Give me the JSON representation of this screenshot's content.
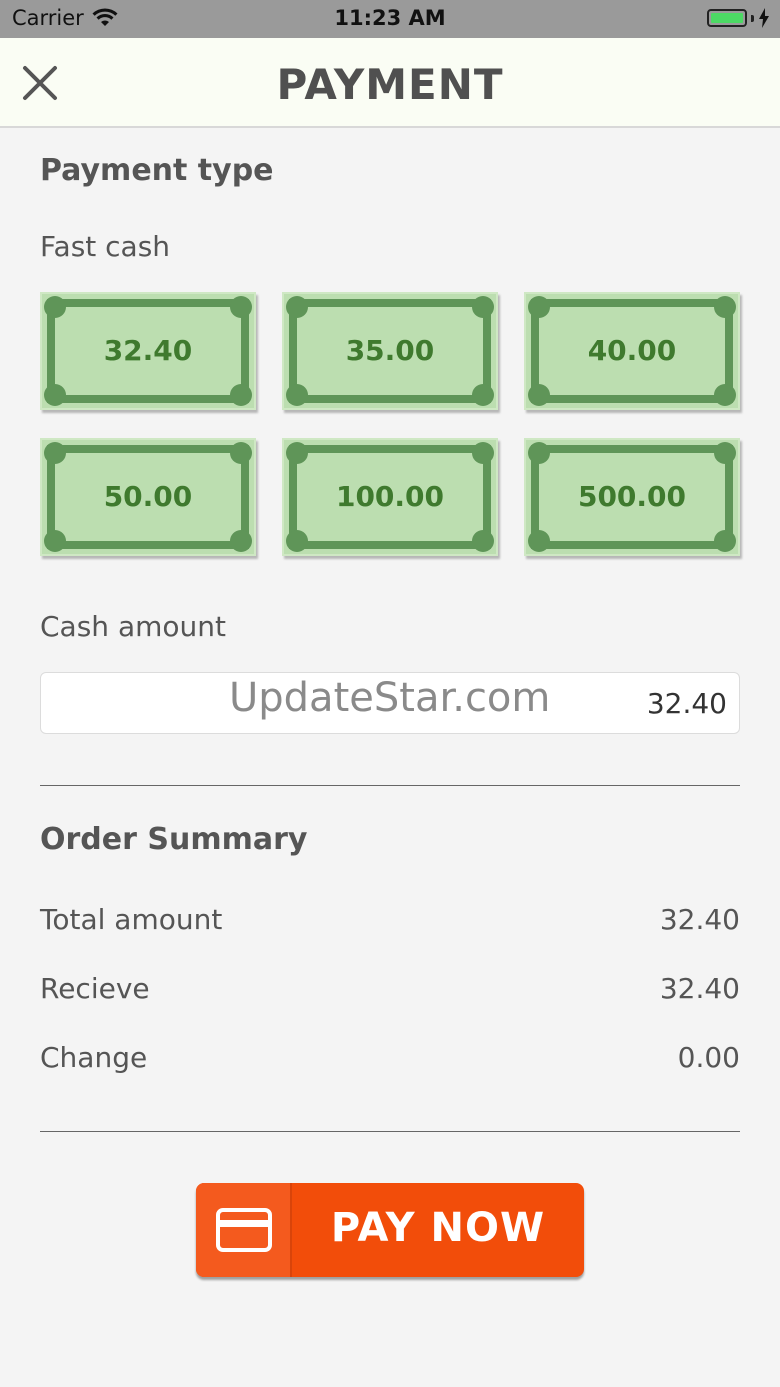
{
  "status_bar": {
    "carrier": "Carrier",
    "time": "11:23 AM",
    "battery_color": "#4cd964"
  },
  "header": {
    "title": "PAYMENT",
    "close_icon": "close-icon"
  },
  "payment_type": {
    "title": "Payment type",
    "fast_cash_label": "Fast cash",
    "notes": [
      "32.40",
      "35.00",
      "40.00",
      "50.00",
      "100.00",
      "500.00"
    ]
  },
  "cash": {
    "label": "Cash amount",
    "value": "32.40",
    "watermark": "UpdateStar.com"
  },
  "summary": {
    "title": "Order Summary",
    "rows": [
      {
        "label": "Total amount",
        "value": "32.40"
      },
      {
        "label": "Recieve",
        "value": "32.40"
      },
      {
        "label": "Change",
        "value": "0.00"
      }
    ]
  },
  "pay_button": {
    "label": "PAY NOW",
    "icon": "credit-card-icon",
    "color": "#f24d0a"
  }
}
